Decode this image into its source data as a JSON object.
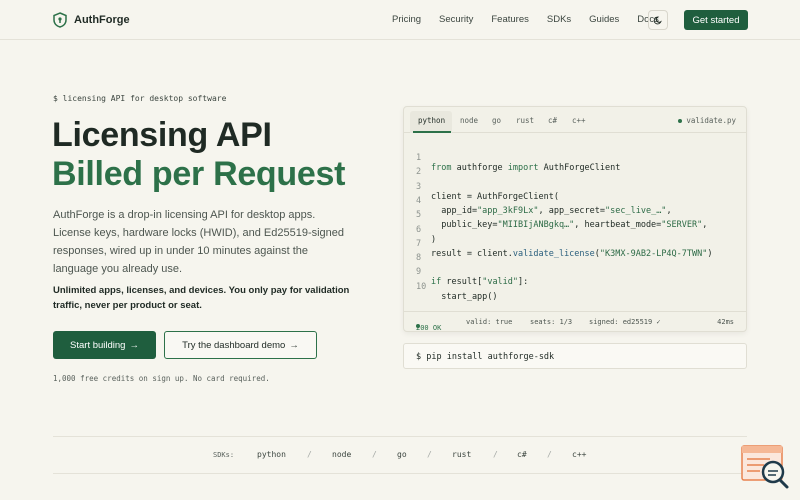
{
  "nav": {
    "brand": "AuthForge",
    "links": [
      "Pricing",
      "Security",
      "Features",
      "SDKs",
      "Guides",
      "Docs"
    ],
    "theme_icon": "moon-icon",
    "cta": "Get started"
  },
  "hero": {
    "eyebrow": "$ licensing API for desktop software",
    "title_line1": "Licensing API",
    "title_line2": "Billed per Request",
    "description": "AuthForge is a drop-in licensing API for desktop apps. License keys, hardware locks (HWID), and Ed25519-signed responses, wired up in under 10 minutes against the language you already use.",
    "note": "Unlimited apps, licenses, and devices. You only pay for validation traffic, never per product or seat.",
    "primary_button": "Start building",
    "secondary_button": "Try the dashboard demo",
    "fine_print": "1,000 free credits on sign up. No card required."
  },
  "code_card": {
    "tabs": [
      "python",
      "node",
      "go",
      "rust",
      "c#",
      "c++"
    ],
    "active_tab": "python",
    "filename": "validate.py",
    "status_ok": "200 OK",
    "status_valid": "valid: true",
    "status_seats": "seats: 1/3",
    "status_signed": "signed: ed25519 ✓",
    "status_time": "42ms",
    "lines": {
      "n1": "1",
      "n2": "2",
      "n3": "3",
      "n4": "4",
      "n5": "5",
      "n6": "6",
      "n7": "7",
      "n8": "8",
      "n9": "9",
      "n10": "10",
      "l1_from": "from",
      "l1_mod": " authforge ",
      "l1_import": "import",
      "l1_cls": " AuthForgeClient",
      "l3": "client = AuthForgeClient(",
      "l4_key": "  app_id=",
      "l4_v1": "\"app_3kF9Lx\"",
      "l4_mid": ", app_secret=",
      "l4_v2": "\"sec_live_…\"",
      "l4_end": ",",
      "l5_key": "  public_key=",
      "l5_v1": "\"MIIBIjANBgkq…\"",
      "l5_mid": ", heartbeat_mode=",
      "l5_v2": "\"SERVER\"",
      "l5_end": ",",
      "l6": ")",
      "l7_a": "result = client.",
      "l7_fn": "validate_license",
      "l7_b": "(",
      "l7_v": "\"K3MX-9AB2-LP4Q-7TWN\"",
      "l7_c": ")",
      "l9_if": "if",
      "l9_a": " result[",
      "l9_v": "\"valid\"",
      "l9_b": "]:",
      "l10": "  start_app()"
    }
  },
  "install": "$ pip install authforge-sdk",
  "sdk_strip": {
    "label": "SDKs:",
    "items": [
      "python",
      "node",
      "go",
      "rust",
      "c#",
      "c++"
    ],
    "separator": "/"
  },
  "colors": {
    "accent": "#1f5e3e",
    "accent_text": "#2d7149",
    "background": "#f6f5ee"
  }
}
